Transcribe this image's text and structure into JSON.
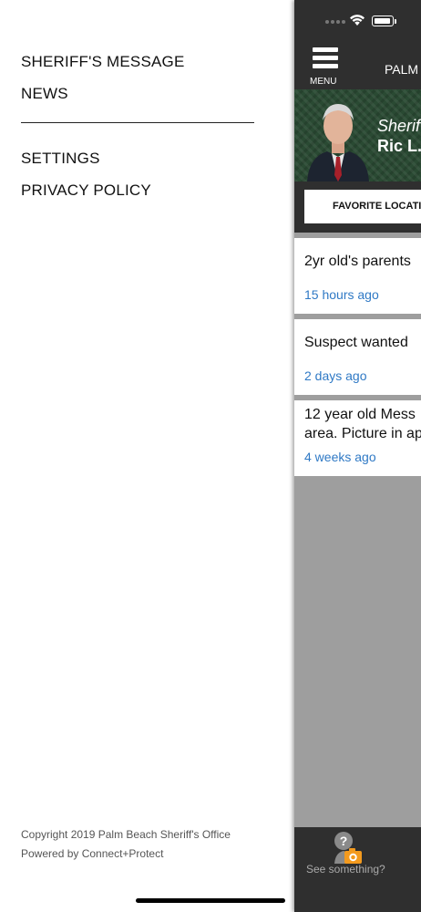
{
  "drawer": {
    "items": [
      {
        "label": "SHERIFF'S MESSAGE"
      },
      {
        "label": "NEWS"
      },
      {
        "label": "SETTINGS"
      },
      {
        "label": "PRIVACY POLICY"
      }
    ],
    "footer": {
      "copyright": "Copyright 2019 Palm Beach Sheriff's Office",
      "powered_by": "Powered by Connect+Protect"
    }
  },
  "app": {
    "menu_label": "MENU",
    "title": "PALM",
    "banner": {
      "line1": "Sherif",
      "line2": "Ric L."
    },
    "favorite_button": "FAVORITE LOCATIO",
    "news": [
      {
        "title": "2yr old's parents",
        "time": "15 hours ago"
      },
      {
        "title": "Suspect wanted",
        "time": "2 days ago"
      },
      {
        "title_line1": "12 year old Mess",
        "title_line2": "area. Picture in ap",
        "time": "4 weeks ago"
      }
    ],
    "tabbar": {
      "see_something": "See something?"
    }
  },
  "colors": {
    "dark_bar": "#2f2f2f",
    "panel_background": "#9e9e9e",
    "timestamp_blue": "#2f79c5"
  },
  "icons": [
    "hamburger-icon",
    "wifi-icon",
    "battery-icon",
    "see-something-icon"
  ]
}
